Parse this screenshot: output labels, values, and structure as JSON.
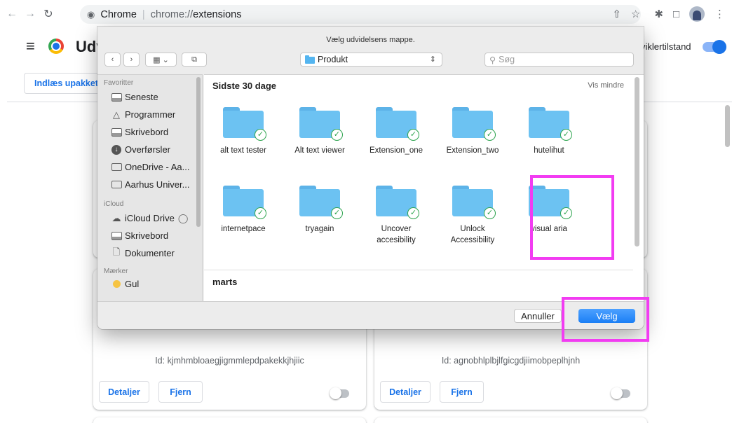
{
  "browser": {
    "omnibox_brand": "Chrome",
    "url_scheme": "chrome://",
    "url_path": "extensions",
    "icons": [
      "back-arrow",
      "forward-arrow",
      "reload",
      "share",
      "star",
      "puzzle",
      "sidebar",
      "avatar",
      "more"
    ]
  },
  "page": {
    "title": "Udv",
    "dev_mode_label": "viklertilstand",
    "load_unpacked_label": "Indlæs upakket",
    "cards": [
      {
        "id_text": "Id: kjmhmbloaegjigmmlepdpakekkjhjiic",
        "details_label": "Detaljer",
        "remove_label": "Fjern"
      },
      {
        "id_text": "Id: agnobhlplbjlfgicgdjiimobpeplhjnh",
        "details_label": "Detaljer",
        "remove_label": "Fjern"
      }
    ]
  },
  "dialog": {
    "title": "Vælg udvidelsens mappe.",
    "current_folder": "Produkt",
    "search_placeholder": "Søg",
    "sidebar": {
      "favorites_title": "Favoritter",
      "favorites": [
        {
          "label": "Seneste",
          "icon": "recents-icon"
        },
        {
          "label": "Programmer",
          "icon": "applications-icon"
        },
        {
          "label": "Skrivebord",
          "icon": "desktop-icon"
        },
        {
          "label": "Overførsler",
          "icon": "downloads-icon"
        },
        {
          "label": "OneDrive - Aa...",
          "icon": "folder-icon"
        },
        {
          "label": "Aarhus Univer...",
          "icon": "folder-icon"
        }
      ],
      "icloud_title": "iCloud",
      "icloud": [
        {
          "label": "iCloud Drive",
          "icon": "cloud-icon"
        },
        {
          "label": "Skrivebord",
          "icon": "desktop-icon"
        },
        {
          "label": "Dokumenter",
          "icon": "document-icon"
        }
      ],
      "tags_title": "Mærker",
      "tags": [
        {
          "label": "Gul",
          "color": "#f6c443"
        }
      ]
    },
    "sections": [
      {
        "title": "Sidste 30 dage",
        "toggle_label": "Vis mindre",
        "folders": [
          {
            "name": "alt text tester"
          },
          {
            "name": "Alt text viewer"
          },
          {
            "name": "Extension_one"
          },
          {
            "name": "Extension_two"
          },
          {
            "name": "hutelihut"
          },
          {
            "name": "internetpace"
          },
          {
            "name": "tryagain"
          },
          {
            "name": "Uncover accesibility"
          },
          {
            "name": "Unlock Accessibility",
            "highlighted": true
          },
          {
            "name": "visual aria"
          }
        ]
      },
      {
        "title": "marts"
      }
    ],
    "cancel_label": "Annuller",
    "confirm_label": "Vælg"
  },
  "colors": {
    "highlight": "#f23cf2",
    "accent_blue": "#1a73e8",
    "folder_blue": "#6cc2f2",
    "check_green": "#2ea44f"
  }
}
